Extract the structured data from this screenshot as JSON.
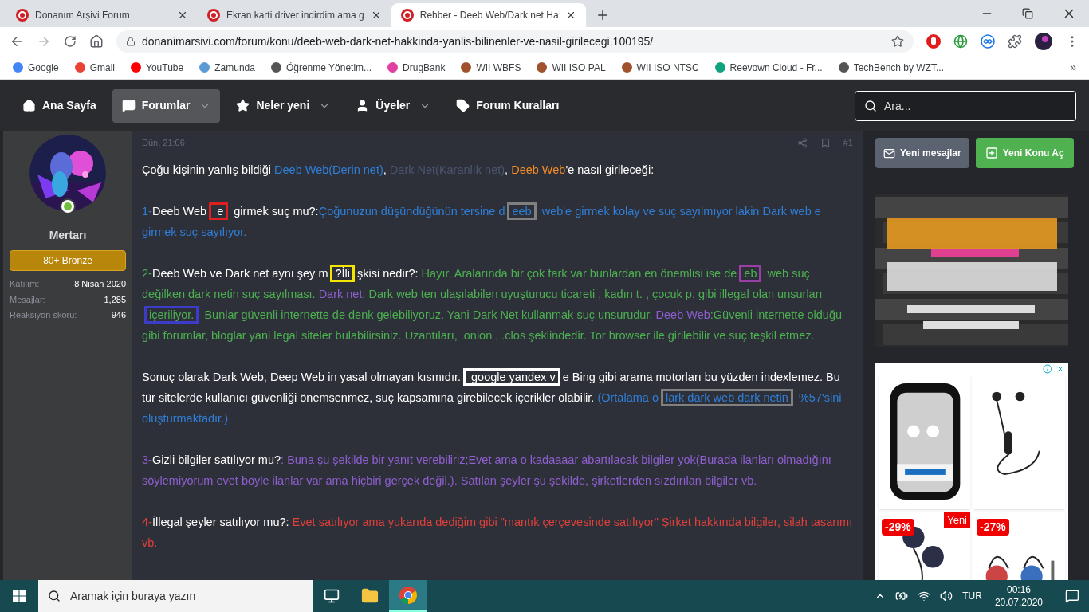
{
  "browser": {
    "tabs": [
      {
        "title": "Donanım Arşivi Forum",
        "selected": false
      },
      {
        "title": "Ekran karti driver indirdim ama g",
        "selected": false
      },
      {
        "title": "Rehber - Deeb Web/Dark net Ha",
        "selected": true
      }
    ],
    "address": "donanimarsivi.com/forum/konu/deeb-web-dark-net-hakkinda-yanlis-bilinenler-ve-nasil-girilecegi.100195/",
    "bookmarks": [
      "Google",
      "Gmail",
      "YouTube",
      "Zamunda",
      "Öğrenme Yönetim...",
      "DrugBank",
      "WII WBFS",
      "WII ISO PAL",
      "WII ISO NTSC",
      "Reevown Cloud - Fr...",
      "TechBench by WZT..."
    ],
    "bookmarks_more": "»"
  },
  "nav": {
    "items": [
      {
        "label": "Ana Sayfa",
        "selected": false,
        "dropdown": false
      },
      {
        "label": "Forumlar",
        "selected": true,
        "dropdown": true
      },
      {
        "label": "Neler yeni",
        "selected": false,
        "dropdown": true
      },
      {
        "label": "Üyeler",
        "selected": false,
        "dropdown": true
      },
      {
        "label": "Forum Kuralları",
        "selected": false,
        "dropdown": false
      }
    ],
    "search": {
      "placeholder": "Ara..."
    }
  },
  "user": {
    "name": "Mertarı",
    "online": true,
    "badge": "80+ Bronze",
    "stats": [
      {
        "label": "Katılım:",
        "value": "8 Nisan 2020"
      },
      {
        "label": "Mesajlar:",
        "value": "1,285"
      },
      {
        "label": "Reaksiyon skoru:",
        "value": "946"
      }
    ]
  },
  "post": {
    "date": "Dün, 21:06",
    "number": "#1",
    "paragraphs": [
      [
        {
          "text": "Çoğu kişinin yanlış bildiği ",
          "color": "#ffffff"
        },
        {
          "text": "Deeb Web(Derin net)",
          "color": "#2f7fd8"
        },
        {
          "text": ", "
        },
        {
          "text": "Dark Net(Karanlık net)",
          "color": "#4a5670"
        },
        {
          "text": ", "
        },
        {
          "text": "Deeb Web",
          "color": "#f28c28"
        },
        {
          "text": "'e nasıl girileceği:",
          "color": "#ffffff"
        }
      ],
      [
        {
          "text": "1-",
          "color": "#2f7fd8"
        },
        {
          "text": "Deeb Web",
          "color": "#ffffff"
        },
        {
          "text": " e",
          "color": "#ffffff",
          "box": {
            "color": "#e02020"
          }
        },
        {
          "text": " girmek suç mu?:",
          "color": "#ffffff"
        },
        {
          "text": "Çoğunuzun düşündüğünün tersine d",
          "color": "#2f7fd8"
        },
        {
          "text": "eeb",
          "color": "#2f7fd8",
          "box": {
            "color": "#808080"
          }
        },
        {
          "text": " web'e girmek kolay ve suç sayılmıyor lakin Dark web e girmek suç sayılıyor.",
          "color": "#2f7fd8"
        }
      ],
      [
        {
          "text": "2-",
          "color": "#4cb050"
        },
        {
          "text": "Deeb Web ve Dark net aynı şey m",
          "color": "#ffffff"
        },
        {
          "text": "?İli",
          "color": "#ffffff",
          "box": {
            "color": "#f2e600"
          }
        },
        {
          "text": "şkisi nedir?: ",
          "color": "#ffffff"
        },
        {
          "text": "Hayır, Aralarında bir çok fark var bunlardan en önemlisi ise de",
          "color": "#4cb050"
        },
        {
          "text": "eb",
          "color": "#4cb050",
          "box": {
            "color": "#9b3fa8"
          }
        },
        {
          "text": " web suç değilken dark netin suç sayılması. ",
          "color": "#4cb050"
        },
        {
          "text": "Dark net",
          "color": "#8e5fd0"
        },
        {
          "text": ": Dark web ten ulaşılabilen uyuşturucu ticareti , kadın t. , çocuk p. gibi illegal olan unsurları ",
          "color": "#4cb050"
        },
        {
          "text": "içeriliyor.",
          "color": "#4cb050",
          "box": {
            "color": "#3c3cc8"
          }
        },
        {
          "text": " Bunlar güvenli internette de denk gelebiliyoruz. Yani Dark Net kullanmak suç unsurudur. ",
          "color": "#4cb050"
        },
        {
          "text": "Deeb Web",
          "color": "#8e5fd0"
        },
        {
          "text": ":Güvenli internette olduğu gibi forumlar, bloglar yani legal siteler bulabilirsiniz. Uzantıları, .onion , .clos şeklindedir. Tor browser ile girilebilir ve suç teşkil etmez.",
          "color": "#4cb050"
        }
      ],
      [
        {
          "text": "Sonuç olarak Dark Web, Deep Web in yasal olmayan kısmıdır.",
          "color": "#ffffff"
        },
        {
          "text": " google yandex v",
          "color": "#ffffff",
          "box": {
            "color": "#ffffff"
          }
        },
        {
          "text": "e Bing gibi arama motorları bu yüzden indexlemez. Bu tür sitelerde kullanıcı güvenliği önemsenmez, suç kapsamına girebilecek içerikler olabilir. ",
          "color": "#ffffff"
        },
        {
          "text": "(Ortalama o",
          "color": "#2f7fd8"
        },
        {
          "text": "lark dark web dark netin",
          "color": "#2f7fd8",
          "box": {
            "color": "#808080"
          }
        },
        {
          "text": " %57'sini oluşturmaktadır.)",
          "color": "#2f7fd8"
        }
      ],
      [
        {
          "text": "3-",
          "color": "#8e5fd0"
        },
        {
          "text": "Gizli bilgiler satılıyor mu?",
          "color": "#ffffff"
        },
        {
          "text": ": Buna şu şekilde bir yanıt verebiliriz;Evet ama o kadaaaar abartılacak bilgiler yok(Burada ilanları olmadığını söylemiyorum evet böyle ilanlar var ama hiçbiri gerçek değil.). Satılan şeyler şu şekilde, şirketlerden sızdırılan bilgiler vb.",
          "color": "#8e5fd0"
        }
      ],
      [
        {
          "text": "4-",
          "color": "#e0403a"
        },
        {
          "text": "İllegal şeyler satılıyor mu?: ",
          "color": "#ffffff"
        },
        {
          "text": "Evet satılıyor ama yukarıda dediğim gibi \"mantık çerçevesinde satılıyor\" Şirket hakkında bilgiler, silah tasarımı vb.",
          "color": "#e0403a"
        }
      ]
    ]
  },
  "sidebar": {
    "buttons": [
      {
        "label": "Yeni mesajlar",
        "kind": "secondary"
      },
      {
        "label": "Yeni Konu Aç",
        "kind": "primary"
      }
    ],
    "banner": {
      "kind": "picture"
    },
    "products": [
      {
        "kind": "picture"
      },
      {
        "kind": "picture"
      },
      {
        "kind": "picture",
        "discount": "-29%",
        "tag": "Yeni"
      },
      {
        "kind": "picture",
        "discount": "-27%"
      }
    ]
  },
  "taskbar": {
    "search_placeholder": "Aramak için buraya yazın",
    "apps": [
      {
        "kind": "taskview",
        "selected": false
      },
      {
        "kind": "explorer",
        "selected": false
      },
      {
        "kind": "chrome",
        "selected": true
      }
    ],
    "language": "TUR",
    "time": "00:16",
    "date": "20.07.2020"
  }
}
